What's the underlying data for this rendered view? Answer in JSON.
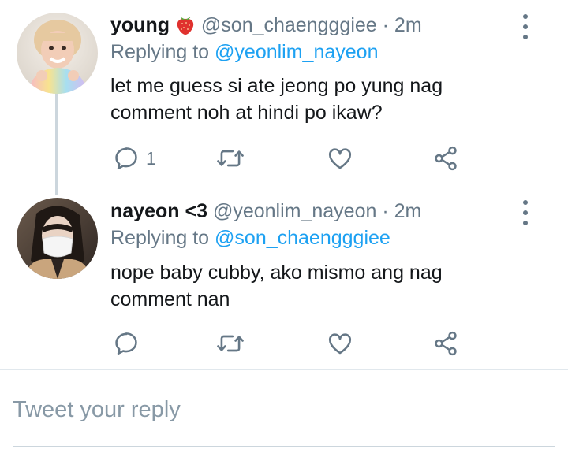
{
  "tweets": [
    {
      "name": "young",
      "emoji": "🍓",
      "handle": "@son_chaengggiee",
      "dot": "·",
      "time": "2m",
      "replying_prefix": "Replying to",
      "replying_to": "@yeonlim_nayeon",
      "text": "let me guess si ate jeong po yung nag comment noh at hindi po ikaw?",
      "reply_count": "1",
      "icons": [
        "reply-icon",
        "retweet-icon",
        "like-icon",
        "share-icon",
        "more-icon"
      ]
    },
    {
      "name": "nayeon <3",
      "handle": "@yeonlim_nayeon",
      "dot": "·",
      "time": "2m",
      "replying_prefix": "Replying to",
      "replying_to": "@son_chaengggiee",
      "text": "nope baby cubby, ako mismo ang nag comment nan",
      "icons": [
        "reply-icon",
        "retweet-icon",
        "like-icon",
        "share-icon",
        "more-icon"
      ]
    }
  ],
  "reply_box": {
    "placeholder": "Tweet your reply"
  },
  "colors": {
    "link": "#1da1f2",
    "secondary_text": "#657786",
    "thread_line": "#ccd6dd",
    "placeholder": "#8899a6"
  }
}
